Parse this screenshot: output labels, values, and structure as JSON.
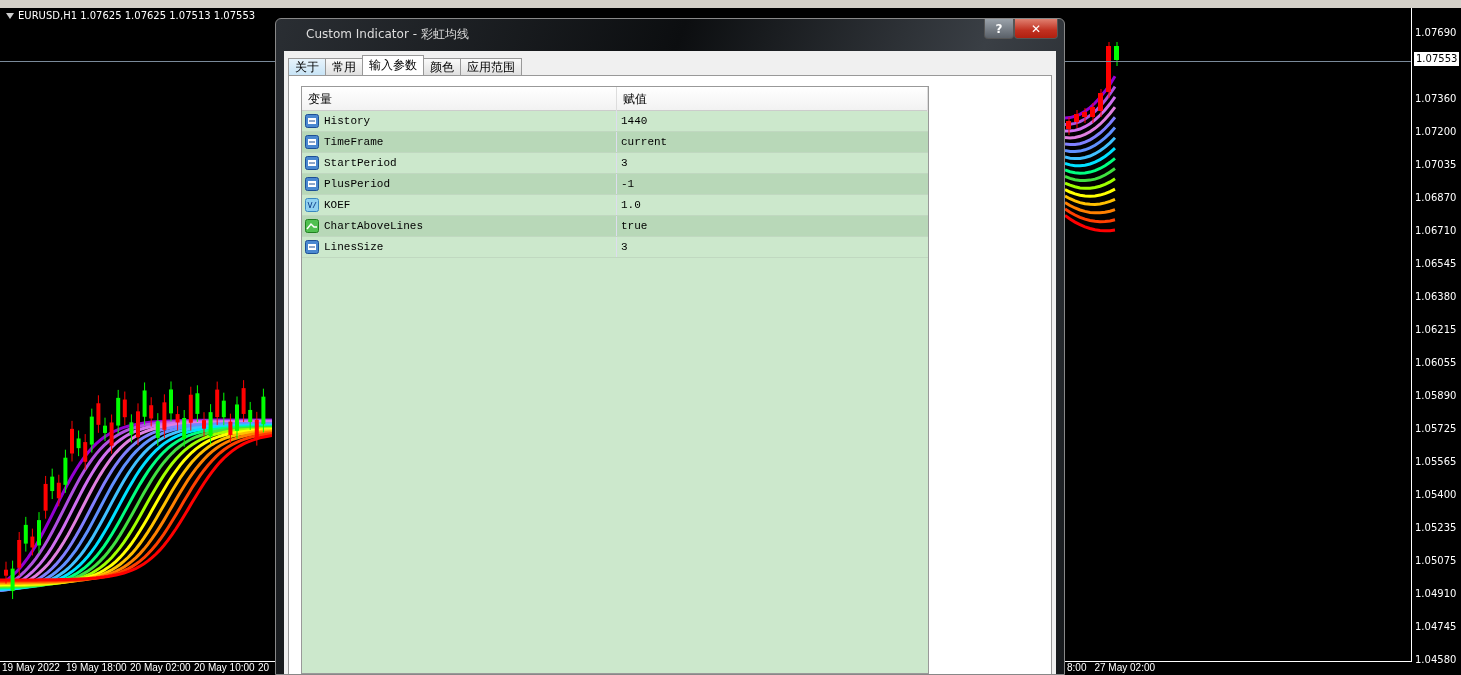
{
  "chart": {
    "header": "EURUSD,H1  1.07625 1.07625 1.07513 1.07553",
    "price_labels": [
      "1.07690",
      "1.07360",
      "1.07200",
      "1.07035",
      "1.06870",
      "1.06710",
      "1.06545",
      "1.06380",
      "1.06215",
      "1.06055",
      "1.05890",
      "1.05725",
      "1.05565",
      "1.05400",
      "1.05235",
      "1.05075",
      "1.04910",
      "1.04745",
      "1.04580"
    ],
    "current_price": "1.07553",
    "time_labels_left": [
      "19 May 2022",
      "19 May 18:00",
      "20 May 02:00",
      "20 May 10:00",
      "20"
    ],
    "time_labels_right": [
      "8:00",
      "27 May 02:00"
    ]
  },
  "dialog": {
    "title": "Custom Indicator - 彩虹均线",
    "buttons": [
      {
        "kind": "help",
        "label": "?"
      },
      {
        "kind": "close",
        "label": "✕"
      }
    ],
    "tabs": [
      {
        "label": "关于",
        "selected": false
      },
      {
        "label": "常用",
        "selected": false
      },
      {
        "label": "输入参数",
        "selected": true
      },
      {
        "label": "颜色",
        "selected": false
      },
      {
        "label": "应用范围",
        "selected": false
      }
    ],
    "table": {
      "columns": [
        "变量",
        "赋值"
      ],
      "rows": [
        {
          "kind": "int",
          "name": "History",
          "value": "1440"
        },
        {
          "kind": "int",
          "name": "TimeFrame",
          "value": "current"
        },
        {
          "kind": "int",
          "name": "StartPeriod",
          "value": "3"
        },
        {
          "kind": "int",
          "name": "PlusPeriod",
          "value": "-1"
        },
        {
          "kind": "double",
          "name": "KOEF",
          "value": "1.0"
        },
        {
          "kind": "bool",
          "name": "ChartAboveLines",
          "value": "true"
        },
        {
          "kind": "int",
          "name": "LinesSize",
          "value": "3"
        }
      ]
    }
  }
}
